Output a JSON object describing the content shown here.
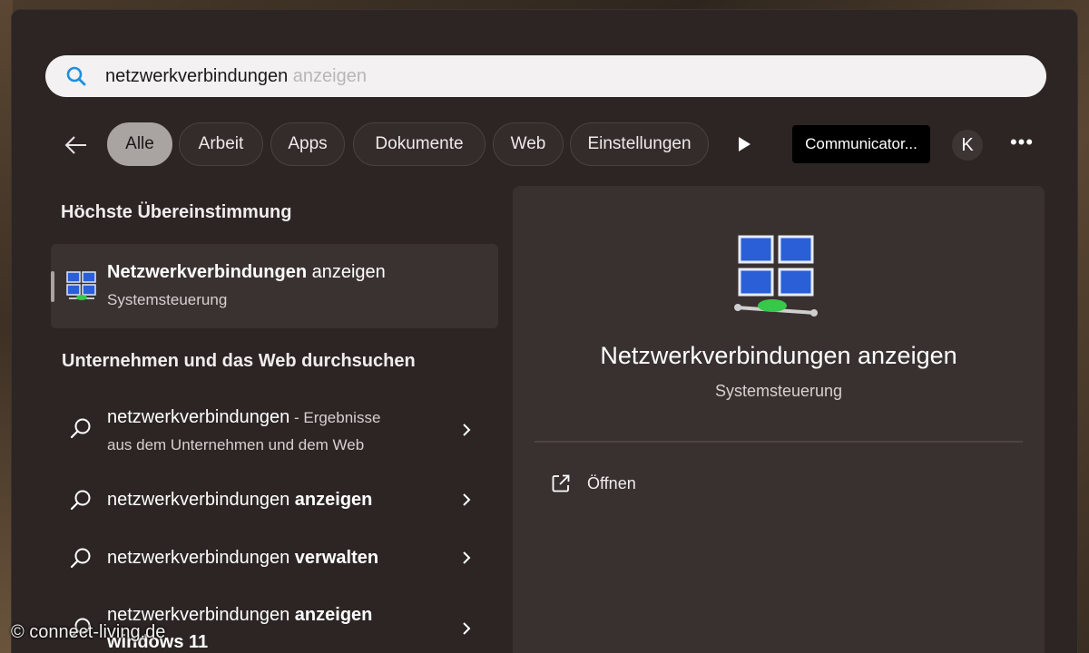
{
  "search": {
    "typed": "netzwerkverbindungen",
    "suggestion": " anzeigen"
  },
  "filters": {
    "tabs": [
      "Alle",
      "Arbeit",
      "Apps",
      "Dokumente",
      "Web",
      "Einstellungen"
    ],
    "active": "Alle",
    "profile": "Communicator...",
    "avatar_letter": "K",
    "more": "•••"
  },
  "best_match": {
    "heading": "Höchste Übereinstimmung",
    "title_bold": "Netzwerkverbindungen",
    "title_rest": " anzeigen",
    "subtitle": "Systemsteuerung"
  },
  "web_section": {
    "heading": "Unternehmen und das Web durchsuchen",
    "items": [
      {
        "plain": "netzwerkverbindungen",
        "bold": "",
        "suffix": " - Ergebnisse",
        "line2": "aus dem Unternehmen und dem Web"
      },
      {
        "plain": "netzwerkverbindungen ",
        "bold": "anzeigen",
        "suffix": "",
        "line2": ""
      },
      {
        "plain": "netzwerkverbindungen ",
        "bold": "verwalten",
        "suffix": "",
        "line2": ""
      },
      {
        "plain": "netzwerkverbindungen ",
        "bold": "anzeigen",
        "suffix": "",
        "line2": "windows 11"
      }
    ]
  },
  "preview": {
    "title": "Netzwerkverbindungen anzeigen",
    "subtitle": "Systemsteuerung",
    "action_open": "Öffnen"
  },
  "watermark": "© connect-living.de",
  "colors": {
    "panel": "#2c2524",
    "card": "#393130",
    "active_chip": "#a9a3a2",
    "search_bg": "#f3f1f1",
    "accent_blue": "#1f8fdc"
  }
}
